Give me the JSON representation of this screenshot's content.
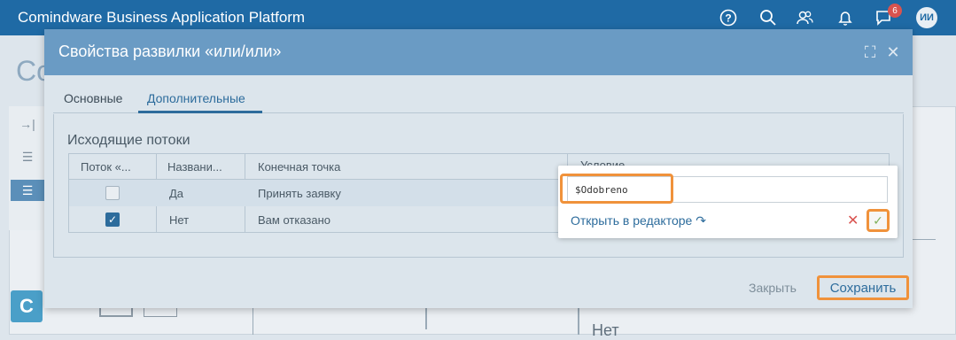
{
  "app": {
    "title": "Comindware Business Application Platform",
    "notifications_badge": "6",
    "user_initials": "ИИ"
  },
  "background": {
    "heading_fragment": "Co",
    "canvas_label": "Нет",
    "logo_letter": "C"
  },
  "modal": {
    "title": "Свойства развилки «или/или»",
    "tabs": [
      {
        "label": "Основные",
        "active": false
      },
      {
        "label": "Дополнительные",
        "active": true
      }
    ],
    "section_title": "Исходящие потоки",
    "table": {
      "headers": [
        "Поток «...",
        "Названи...",
        "Конечная точка",
        "Условие"
      ],
      "rows": [
        {
          "checked": false,
          "name": "Да",
          "endpoint": "Принять заявку"
        },
        {
          "checked": true,
          "name": "Нет",
          "endpoint": "Вам отказано"
        }
      ]
    },
    "close_label": "Закрыть",
    "save_label": "Сохранить"
  },
  "editor_popup": {
    "value": "$Odobreno",
    "open_in_editor_label": "Открыть в редакторе"
  },
  "colors": {
    "topbar": "#1f6aa5",
    "modal_header": "#6a9bc4",
    "highlight": "#f0923b",
    "link": "#2d6c9c"
  }
}
